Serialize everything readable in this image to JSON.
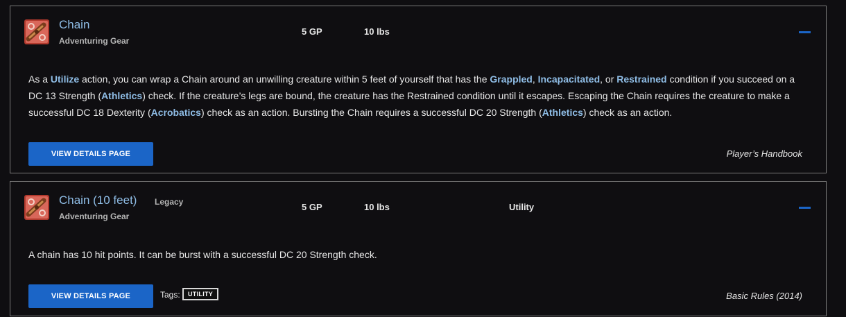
{
  "items": [
    {
      "name": "Chain",
      "subtype": "Adventuring Gear",
      "cost": "5 GP",
      "weight": "10 lbs",
      "description": [
        {
          "t": "As a "
        },
        {
          "t": "Utilize",
          "kw": true
        },
        {
          "t": " action, you can wrap a Chain around an unwilling creature within 5 feet of yourself that has the "
        },
        {
          "t": "Grappled",
          "kw": true
        },
        {
          "t": ", "
        },
        {
          "t": "Incapacitated",
          "kw": true
        },
        {
          "t": ", or "
        },
        {
          "t": "Restrained",
          "kw": true
        },
        {
          "t": " condition if you succeed on a DC 13 Strength ("
        },
        {
          "t": "Athletics",
          "kw": true
        },
        {
          "t": ") check. If the creature’s legs are bound, the creature has the Restrained condition until it escapes. Escaping the Chain requires the creature to make a successful DC 18 Dexterity ("
        },
        {
          "t": "Acrobatics",
          "kw": true
        },
        {
          "t": ") check as an action. Bursting the Chain requires a successful DC 20 Strength ("
        },
        {
          "t": "Athletics",
          "kw": true
        },
        {
          "t": ") check as an action."
        }
      ],
      "button_label": "VIEW DETAILS PAGE",
      "source": "Player’s Handbook"
    },
    {
      "name": "Chain (10 feet)",
      "badge": "Legacy",
      "subtype": "Adventuring Gear",
      "cost": "5 GP",
      "weight": "10 lbs",
      "category": "Utility",
      "description_text": "A chain has 10 hit points. It can be burst with a successful DC 20 Strength check.",
      "button_label": "VIEW DETAILS PAGE",
      "tags_label": "Tags:",
      "tags": [
        "UTILITY"
      ],
      "source": "Basic Rules (2014)"
    }
  ],
  "icons": {
    "item_thumbnail": "chain-item-icon",
    "collapse": "minus-icon"
  },
  "colors": {
    "accent": "#1b65c7",
    "link": "#8fbde6",
    "background": "#0f0e11",
    "border": "#7b7b7b"
  }
}
